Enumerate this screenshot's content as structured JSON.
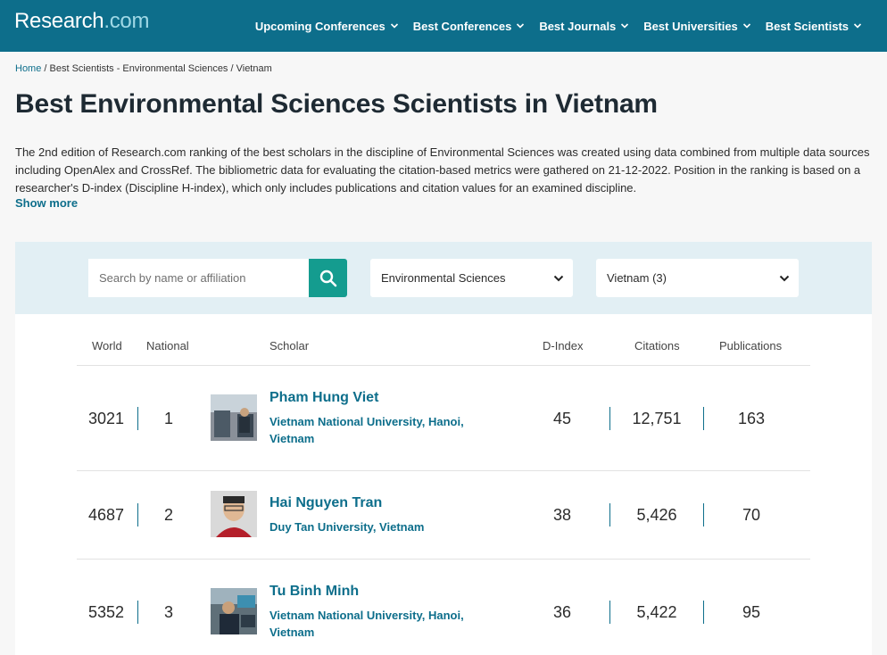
{
  "header": {
    "logo_main": "Research",
    "logo_suffix": ".com",
    "nav": [
      {
        "label": "Upcoming Conferences"
      },
      {
        "label": "Best Conferences"
      },
      {
        "label": "Best Journals"
      },
      {
        "label": "Best Universities"
      },
      {
        "label": "Best Scientists"
      }
    ]
  },
  "breadcrumb": {
    "home": "Home",
    "sep1": " / ",
    "item2": "Best Scientists - Environmental Sciences",
    "sep2": "  / ",
    "item3": "Vietnam"
  },
  "page": {
    "title": "Best Environmental Sciences Scientists in Vietnam",
    "description": "The 2nd edition of Research.com ranking of the best scholars in the discipline of Environmental Sciences was created using data combined from multiple data sources including OpenAlex and CrossRef. The bibliometric data for evaluating the citation-based metrics were gathered on 21-12-2022. Position in the ranking is based on a researcher's D-index (Discipline H-index), which only includes publications and citation values for an examined discipline.",
    "show_more": "Show more"
  },
  "filters": {
    "search_placeholder": "Search by name or affiliation",
    "search_icon": "search-icon",
    "discipline": "Environmental Sciences",
    "country": "Vietnam (3)"
  },
  "table": {
    "headers": {
      "world": "World",
      "national": "National",
      "scholar": "Scholar",
      "dindex": "D-Index",
      "citations": "Citations",
      "publications": "Publications"
    },
    "rows": [
      {
        "world": "3021",
        "national": "1",
        "name": "Pham Hung Viet",
        "affiliation": "Vietnam National University, Hanoi, Vietnam",
        "dindex": "45",
        "citations": "12,751",
        "publications": "163"
      },
      {
        "world": "4687",
        "national": "2",
        "name": "Hai Nguyen Tran",
        "affiliation": "Duy Tan University, Vietnam",
        "dindex": "38",
        "citations": "5,426",
        "publications": "70"
      },
      {
        "world": "5352",
        "national": "3",
        "name": "Tu Binh Minh",
        "affiliation": "Vietnam National University, Hanoi, Vietnam",
        "dindex": "36",
        "citations": "5,422",
        "publications": "95"
      }
    ]
  },
  "colors": {
    "brand": "#0d6e8b",
    "search_button": "#149c8f",
    "filter_bg": "#e2eff4"
  }
}
